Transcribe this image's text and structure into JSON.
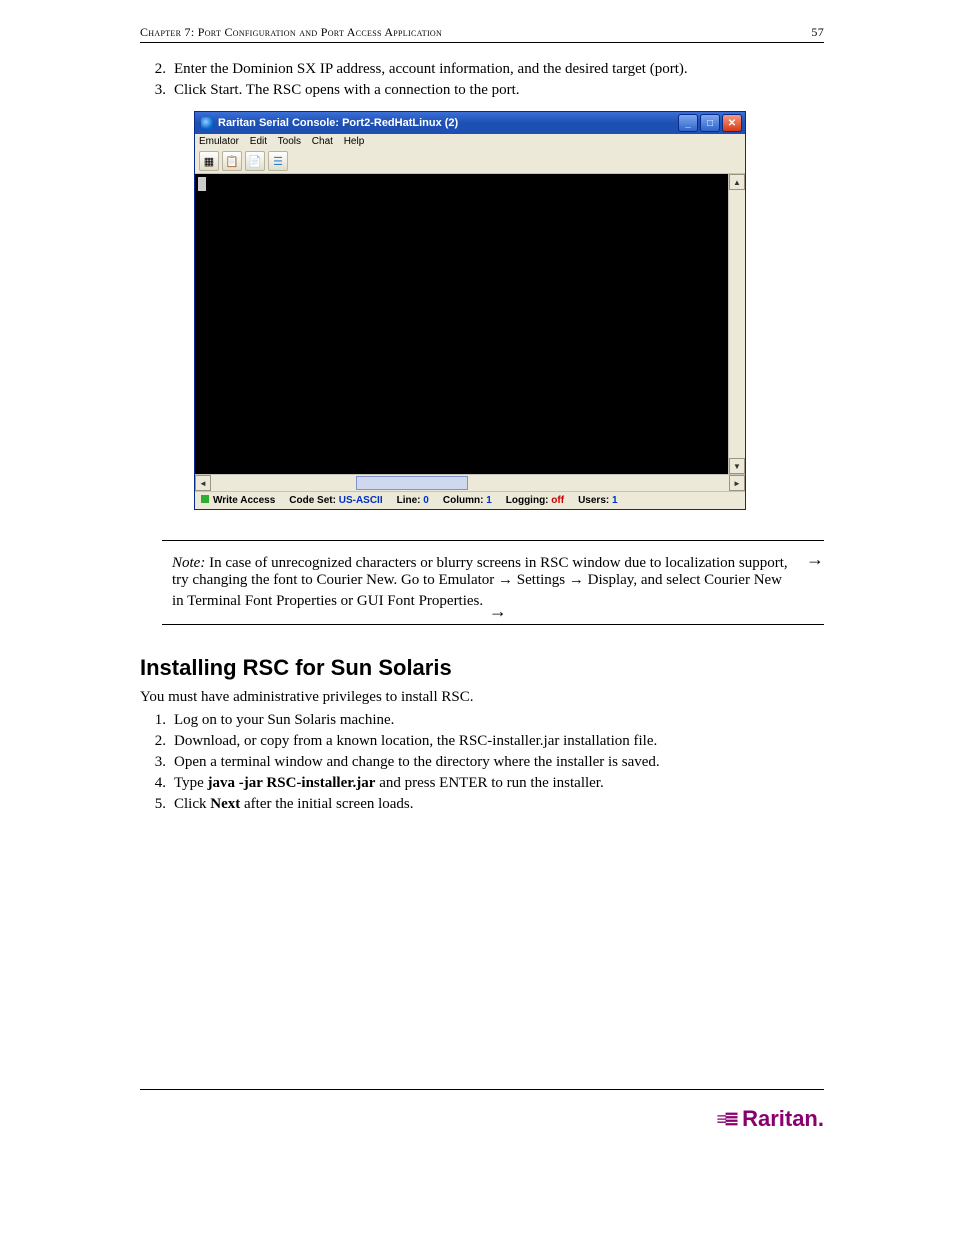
{
  "header": {
    "chapter_label": "Chapter 7: Port Configuration and Port Access Application",
    "page_number": "57"
  },
  "top_steps": [
    {
      "num": "2.",
      "text": "Enter the Dominion SX IP address, account information, and the desired target (port)."
    },
    {
      "num": "3.",
      "text": "Click Start. The RSC opens with a connection to the port."
    }
  ],
  "rsc_window": {
    "title": "Raritan Serial Console: Port2-RedHatLinux (2)",
    "menus": [
      "Emulator",
      "Edit",
      "Tools",
      "Chat",
      "Help"
    ],
    "status": {
      "write_access": "Write Access",
      "code_set_label": "Code Set:",
      "code_set_value": "US-ASCII",
      "line_label": "Line:",
      "line_value": "0",
      "column_label": "Column:",
      "column_value": "1",
      "logging_label": "Logging:",
      "logging_value": "off",
      "users_label": "Users:",
      "users_value": "1"
    }
  },
  "note": {
    "label": "Note:",
    "text": " In case of unrecognized characters or blurry screens in RSC window due to localization support, try changing the font to Courier New. Go to Emulator → Settings → Display, and select Courier New in Terminal Font Properties or GUI Font Properties."
  },
  "section_heading": "Installing RSC for Sun Solaris",
  "section_intro": "You must have administrative privileges to install RSC.",
  "solaris_steps": [
    {
      "num": "1.",
      "text": "Log on to your Sun Solaris machine."
    },
    {
      "num": "2.",
      "text": "Download, or copy from a known location, the RSC-installer.jar installation file."
    },
    {
      "num": "3.",
      "text": "Open a terminal window and change to the directory where the installer is saved."
    },
    {
      "num": "4.",
      "prefix": "Type ",
      "cmd": "java -jar RSC-installer.jar",
      "suffix": " and press ENTER to run the installer."
    },
    {
      "num": "5.",
      "prefix": "Click ",
      "bold": "Next",
      "suffix": " after the initial screen loads."
    }
  ],
  "brand": "Raritan."
}
